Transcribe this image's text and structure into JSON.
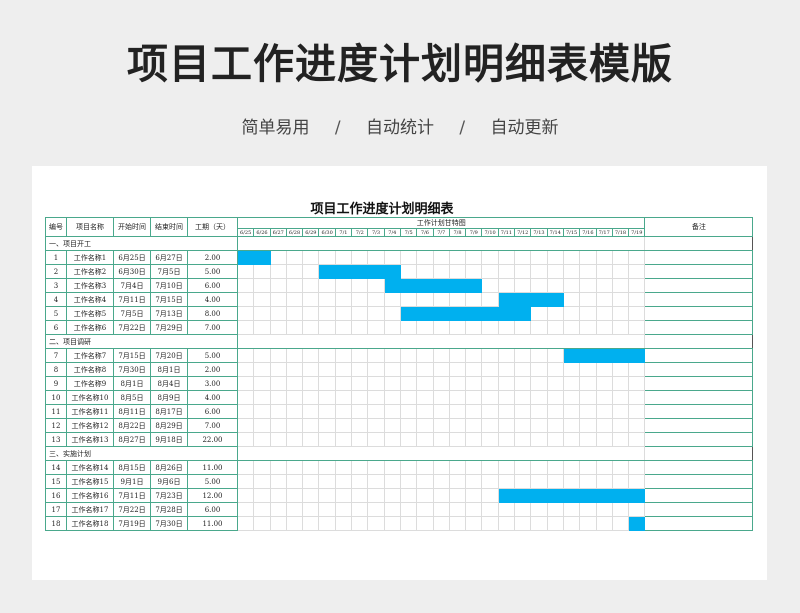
{
  "title": "项目工作进度计划明细表模版",
  "subtitle": [
    "简单易用",
    "/",
    "自动统计",
    "/",
    "自动更新"
  ],
  "sheet_title": "项目工作进度计划明细表",
  "headers": {
    "no": "编号",
    "name": "项目名称",
    "start": "开始时间",
    "end": "结束时间",
    "duration": "工期（天）",
    "gantt": "工作计划甘特图",
    "remark": "备注"
  },
  "dates": [
    "6/25",
    "6/26",
    "6/27",
    "6/28",
    "6/29",
    "6/30",
    "7/1",
    "7/2",
    "7/3",
    "7/4",
    "7/5",
    "7/6",
    "7/7",
    "7/8",
    "7/9",
    "7/10",
    "7/11",
    "7/12",
    "7/13",
    "7/14",
    "7/15",
    "7/16",
    "7/17",
    "7/18",
    "7/19"
  ],
  "bar_color": "#00b0ef",
  "sections": [
    {
      "label": "一、项目开工",
      "rows": [
        {
          "no": "1",
          "name": "工作名称1",
          "start": "6月25日",
          "end": "6月27日",
          "duration": "2.00",
          "bar": [
            0,
            2
          ]
        },
        {
          "no": "2",
          "name": "工作名称2",
          "start": "6月30日",
          "end": "7月5日",
          "duration": "5.00",
          "bar": [
            5,
            10
          ]
        },
        {
          "no": "3",
          "name": "工作名称3",
          "start": "7月4日",
          "end": "7月10日",
          "duration": "6.00",
          "bar": [
            9,
            15
          ]
        },
        {
          "no": "4",
          "name": "工作名称4",
          "start": "7月11日",
          "end": "7月15日",
          "duration": "4.00",
          "bar": [
            16,
            20
          ]
        },
        {
          "no": "5",
          "name": "工作名称5",
          "start": "7月5日",
          "end": "7月13日",
          "duration": "8.00",
          "bar": [
            10,
            18
          ]
        },
        {
          "no": "6",
          "name": "工作名称6",
          "start": "7月22日",
          "end": "7月29日",
          "duration": "7.00",
          "bar": null
        }
      ]
    },
    {
      "label": "二、项目调研",
      "rows": [
        {
          "no": "7",
          "name": "工作名称7",
          "start": "7月15日",
          "end": "7月20日",
          "duration": "5.00",
          "bar": [
            20,
            25
          ]
        },
        {
          "no": "8",
          "name": "工作名称8",
          "start": "7月30日",
          "end": "8月1日",
          "duration": "2.00",
          "bar": null
        },
        {
          "no": "9",
          "name": "工作名称9",
          "start": "8月1日",
          "end": "8月4日",
          "duration": "3.00",
          "bar": null
        },
        {
          "no": "10",
          "name": "工作名称10",
          "start": "8月5日",
          "end": "8月9日",
          "duration": "4.00",
          "bar": null
        },
        {
          "no": "11",
          "name": "工作名称11",
          "start": "8月11日",
          "end": "8月17日",
          "duration": "6.00",
          "bar": null
        },
        {
          "no": "12",
          "name": "工作名称12",
          "start": "8月22日",
          "end": "8月29日",
          "duration": "7.00",
          "bar": null
        },
        {
          "no": "13",
          "name": "工作名称13",
          "start": "8月27日",
          "end": "9月18日",
          "duration": "22.00",
          "bar": null
        }
      ]
    },
    {
      "label": "三、实施计划",
      "rows": [
        {
          "no": "14",
          "name": "工作名称14",
          "start": "8月15日",
          "end": "8月26日",
          "duration": "11.00",
          "bar": null
        },
        {
          "no": "15",
          "name": "工作名称15",
          "start": "9月1日",
          "end": "9月6日",
          "duration": "5.00",
          "bar": null
        },
        {
          "no": "16",
          "name": "工作名称16",
          "start": "7月11日",
          "end": "7月23日",
          "duration": "12.00",
          "bar": [
            16,
            25
          ]
        },
        {
          "no": "17",
          "name": "工作名称17",
          "start": "7月22日",
          "end": "7月28日",
          "duration": "6.00",
          "bar": null
        },
        {
          "no": "18",
          "name": "工作名称18",
          "start": "7月19日",
          "end": "7月30日",
          "duration": "11.00",
          "bar": [
            24,
            25
          ]
        }
      ]
    }
  ]
}
